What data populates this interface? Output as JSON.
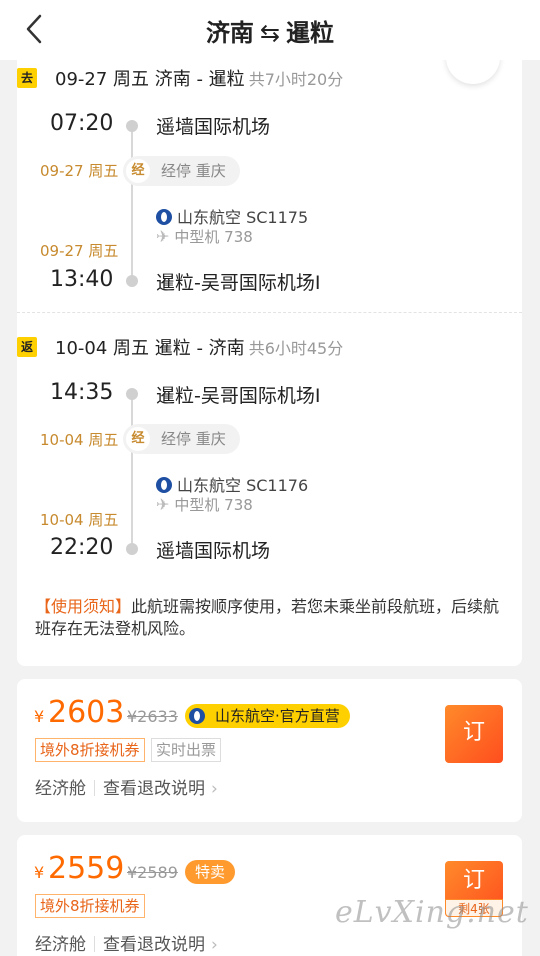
{
  "header": {
    "title_from": "济南",
    "title_arrow": "⇆",
    "title_to": "暹粒"
  },
  "outbound": {
    "tag": "去",
    "heading": "09-27  周五 济南 - 暹粒",
    "duration": "共7小时20分",
    "depart_time": "07:20",
    "depart_airport": "遥墙国际机场",
    "stop_date": "09-27 周五",
    "stop_badge": "经",
    "stop_text": "经停 重庆",
    "airline": "山东航空 SC1175",
    "aircraft": "中型机 738",
    "arrive_date": "09-27 周五",
    "arrive_time": "13:40",
    "arrive_airport": "暹粒-吴哥国际机场I"
  },
  "return": {
    "tag": "返",
    "heading": "10-04  周五 暹粒 - 济南",
    "duration": "共6小时45分",
    "depart_time": "14:35",
    "depart_airport": "暹粒-吴哥国际机场I",
    "stop_date": "10-04 周五",
    "stop_badge": "经",
    "stop_text": "经停 重庆",
    "airline": "山东航空 SC1176",
    "aircraft": "中型机 738",
    "arrive_date": "10-04 周五",
    "arrive_time": "22:20",
    "arrive_airport": "遥墙国际机场"
  },
  "notice": {
    "label": "【使用须知】",
    "text": "此航班需按顺序使用，若您未乘坐前段航班，后续航班存在无法登机风险。"
  },
  "offers": [
    {
      "currency": "¥",
      "price": "2603",
      "old_price": "¥2633",
      "tag": "山东航空·官方直营",
      "chip1": "境外8折接机券",
      "chip2": "实时出票",
      "cabin": "经济舱",
      "refund": "查看退改说明",
      "book": "订"
    },
    {
      "currency": "¥",
      "price": "2559",
      "old_price": "¥2589",
      "tag": "特卖",
      "chip1": "境外8折接机券",
      "cabin": "经济舱",
      "refund": "查看退改说明",
      "book": "订",
      "remain": "剩4张"
    }
  ],
  "watermark": "eLvXing.net",
  "icons": {
    "back": "chevron-left-icon",
    "plane": "airplane-icon",
    "chevron": "chevron-right-icon"
  }
}
